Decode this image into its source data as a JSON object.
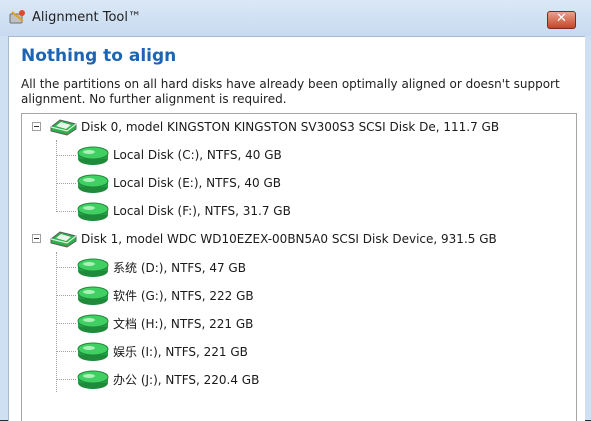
{
  "window": {
    "title": "Alignment Tool™",
    "close_symbol": "✕"
  },
  "content": {
    "heading": "Nothing to align",
    "description": "All the partitions on all hard disks have already been optimally aligned or doesn't support alignment. No further alignment is required."
  },
  "tree": {
    "disks": [
      {
        "label": "Disk 0, model KINGSTON KINGSTON SV300S3 SCSI Disk De, 111.7 GB",
        "icon": "hard-disk-icon",
        "partitions": [
          {
            "label": "Local Disk (C:), NTFS, 40 GB",
            "icon": "partition-icon"
          },
          {
            "label": "Local Disk (E:), NTFS, 40 GB",
            "icon": "partition-icon"
          },
          {
            "label": "Local Disk (F:), NTFS, 31.7 GB",
            "icon": "partition-icon"
          }
        ]
      },
      {
        "label": "Disk 1, model WDC WD10EZEX-00BN5A0 SCSI Disk Device, 931.5 GB",
        "icon": "hard-disk-icon",
        "partitions": [
          {
            "label": "系统 (D:), NTFS, 47 GB",
            "icon": "partition-icon"
          },
          {
            "label": "软件 (G:), NTFS, 222 GB",
            "icon": "partition-icon"
          },
          {
            "label": "文档 (H:), NTFS, 221 GB",
            "icon": "partition-icon"
          },
          {
            "label": "娱乐 (I:), NTFS, 221 GB",
            "icon": "partition-icon"
          },
          {
            "label": "办公 (J:), NTFS, 220.4 GB",
            "icon": "partition-icon"
          }
        ]
      }
    ]
  },
  "colors": {
    "heading": "#1d64b3",
    "disk_green": "#2bb24c",
    "title_bar": "#cfe0f3"
  }
}
